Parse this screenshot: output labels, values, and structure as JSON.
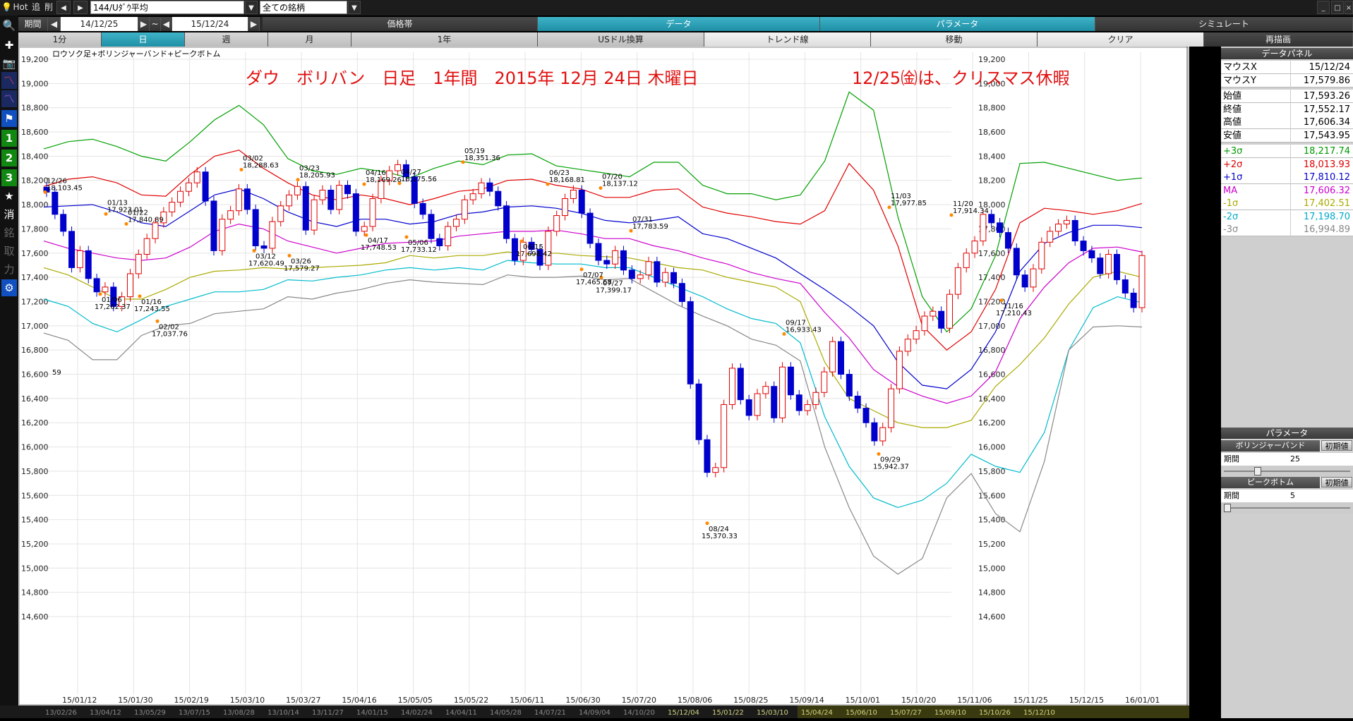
{
  "toolbar": {
    "hot": "Hot",
    "btn_add": "追",
    "btn_del": "削",
    "symbol": "144/Uﾀﾞｳ平均",
    "universe": "全ての銘柄",
    "period_label": "期間",
    "date_from": "14/12/25",
    "date_sep": "~",
    "date_to": "15/12/24"
  },
  "tabs_row1": [
    "価格帯",
    "データ",
    "パラメータ",
    "シミュレート"
  ],
  "tabs_row2": [
    "1分",
    "日",
    "週",
    "月",
    "1年",
    "USドル換算",
    "トレンド線",
    "移動",
    "クリア",
    "再描画"
  ],
  "left_tools": [
    "search-icon",
    "crosshair-icon",
    "camera-icon",
    "chart-red-icon",
    "chart-purple-icon",
    "flag-icon",
    "1",
    "2",
    "3",
    "★",
    "消",
    "銘",
    "取",
    "力"
  ],
  "chart_data": {
    "type": "candlestick",
    "subtitle": "ロウソク足+ボリンジャーバンド+ピークボトム",
    "title": "ダウ　ボリバン　日足　1年間　2015年 12月 24日 木曜日",
    "note": "12/25㈮は、クリスマス休暇",
    "ylim": [
      14600,
      19400
    ],
    "yticks": [
      "19,200",
      "19,000",
      "18,800",
      "18,600",
      "18,400",
      "18,200",
      "18,000",
      "17,800",
      "17,600",
      "17,400",
      "17,200",
      "17,000",
      "16,800",
      "16,600",
      "16,400",
      "16,200",
      "16,000",
      "15,800",
      "15,600",
      "15,400",
      "15,200",
      "15,000",
      "14,800",
      "14,600"
    ],
    "xticks": [
      "15/01/12",
      "15/01/30",
      "15/02/19",
      "15/03/10",
      "15/03/27",
      "15/04/16",
      "15/05/05",
      "15/05/22",
      "15/06/11",
      "15/06/30",
      "15/07/20",
      "15/08/06",
      "15/08/25",
      "15/09/14",
      "15/10/01",
      "15/10/20",
      "15/11/06",
      "15/11/25",
      "15/12/15",
      "16/01/01"
    ],
    "series": [
      {
        "name": "+3σ",
        "color": "#00a000",
        "values": [
          18460,
          18520,
          18540,
          18480,
          18400,
          18360,
          18520,
          18700,
          18820,
          18660,
          18380,
          18280,
          18250,
          18300,
          18270,
          18220,
          18300,
          18360,
          18330,
          18410,
          18420,
          18320,
          18290,
          18260,
          18230,
          18350,
          18350,
          18160,
          18090,
          18090,
          18040,
          18080,
          18360,
          18930,
          18780,
          17900,
          17240,
          16950,
          17140,
          17580,
          18340,
          18350,
          18300,
          18250,
          18200,
          18220
        ]
      },
      {
        "name": "+2σ",
        "color": "#e00000",
        "values": [
          18150,
          18210,
          18230,
          18180,
          18080,
          18070,
          18250,
          18400,
          18450,
          18300,
          18180,
          18080,
          18040,
          18080,
          18050,
          18000,
          18050,
          18110,
          18130,
          18200,
          18210,
          18160,
          18130,
          18060,
          18060,
          18120,
          18130,
          17980,
          17930,
          17900,
          17860,
          17840,
          17950,
          18340,
          18120,
          17660,
          17000,
          16800,
          16950,
          17300,
          17850,
          17970,
          17950,
          17920,
          17950,
          18010
        ]
      },
      {
        "name": "+1σ",
        "color": "#0000cc",
        "values": [
          17980,
          17990,
          18000,
          17940,
          17850,
          17820,
          17950,
          18080,
          18130,
          18050,
          17940,
          17860,
          17820,
          17880,
          17880,
          17840,
          17860,
          17920,
          17940,
          17980,
          17990,
          17970,
          17930,
          17870,
          17850,
          17870,
          17900,
          17760,
          17720,
          17640,
          17560,
          17430,
          17300,
          17160,
          17000,
          16700,
          16510,
          16480,
          16640,
          16950,
          17450,
          17680,
          17770,
          17830,
          17830,
          17810
        ]
      },
      {
        "name": "MA",
        "color": "#cc00cc",
        "values": [
          17700,
          17640,
          17600,
          17560,
          17540,
          17560,
          17650,
          17780,
          17840,
          17800,
          17700,
          17650,
          17600,
          17640,
          17680,
          17690,
          17700,
          17740,
          17760,
          17780,
          17780,
          17790,
          17760,
          17720,
          17720,
          17660,
          17620,
          17560,
          17510,
          17440,
          17390,
          17350,
          17110,
          16900,
          16640,
          16500,
          16420,
          16360,
          16420,
          16620,
          17060,
          17320,
          17520,
          17640,
          17650,
          17610
        ]
      },
      {
        "name": "-1σ",
        "color": "#aaaa00",
        "values": [
          17480,
          17420,
          17320,
          17220,
          17220,
          17300,
          17400,
          17450,
          17460,
          17480,
          17470,
          17480,
          17490,
          17500,
          17520,
          17580,
          17560,
          17580,
          17580,
          17610,
          17590,
          17600,
          17580,
          17570,
          17560,
          17520,
          17480,
          17460,
          17400,
          17360,
          17320,
          17200,
          16700,
          16400,
          16300,
          16200,
          16160,
          16160,
          16220,
          16500,
          16680,
          16900,
          17180,
          17400,
          17450,
          17400
        ]
      },
      {
        "name": "-2σ",
        "color": "#00bbcc",
        "values": [
          17220,
          17160,
          17020,
          16950,
          17050,
          17160,
          17220,
          17280,
          17280,
          17300,
          17380,
          17370,
          17400,
          17420,
          17460,
          17480,
          17460,
          17480,
          17460,
          17540,
          17520,
          17510,
          17510,
          17480,
          17480,
          17400,
          17320,
          17240,
          17140,
          17060,
          17020,
          16860,
          16250,
          15840,
          15580,
          15500,
          15560,
          15700,
          15940,
          15840,
          15790,
          16120,
          16800,
          17150,
          17240,
          17190
        ]
      },
      {
        "name": "-3σ",
        "color": "#888888",
        "values": [
          16940,
          16880,
          16720,
          16720,
          16920,
          17000,
          17020,
          17100,
          17120,
          17140,
          17240,
          17220,
          17270,
          17300,
          17350,
          17380,
          17360,
          17350,
          17340,
          17420,
          17400,
          17400,
          17410,
          17380,
          17390,
          17280,
          17170,
          17080,
          17000,
          16890,
          16840,
          16710,
          16000,
          15500,
          15100,
          14950,
          15080,
          15580,
          15780,
          15450,
          15300,
          15880,
          16800,
          16990,
          17000,
          16990
        ]
      }
    ],
    "candles": [
      18103,
      17920,
      17780,
      17480,
      17620,
      17390,
      17280,
      17320,
      17160,
      17240,
      17430,
      17590,
      17720,
      17850,
      17940,
      18020,
      18110,
      18180,
      18270,
      18030,
      17620,
      17880,
      17950,
      18130,
      17960,
      17660,
      17640,
      17860,
      17990,
      18080,
      18150,
      17790,
      18040,
      18120,
      17960,
      18160,
      18090,
      17780,
      17820,
      18050,
      18200,
      18280,
      18330,
      18230,
      18010,
      17920,
      17720,
      17660,
      17820,
      17880,
      18040,
      18090,
      18180,
      18110,
      17990,
      17720,
      17540,
      17690,
      17630,
      17500,
      17780,
      17910,
      18050,
      18120,
      17930,
      17680,
      17540,
      17510,
      17620,
      17460,
      17390,
      17420,
      17530,
      17360,
      17440,
      17350,
      17200,
      16520,
      16060,
      15790,
      15830,
      16350,
      16650,
      16390,
      16260,
      16440,
      16500,
      16240,
      16660,
      16430,
      16300,
      16350,
      16450,
      16620,
      16870,
      16600,
      16420,
      16320,
      16200,
      16050,
      16160,
      16480,
      16790,
      16890,
      16960,
      17080,
      17120,
      16980,
      17260,
      17480,
      17600,
      17700,
      17920,
      17850,
      17770,
      17640,
      17420,
      17320,
      17470,
      17690,
      17780,
      17840,
      17870,
      17700,
      17620,
      17560,
      17430,
      17590,
      17380,
      17270,
      17150,
      17580
    ],
    "peaks": [
      {
        "date": "12/26",
        "value": "18,103.45"
      },
      {
        "date": "01/13",
        "value": "17,923.01"
      },
      {
        "date": "01/22",
        "value": "17,840.89"
      },
      {
        "date": "03/02",
        "value": "18,288.63"
      },
      {
        "date": "03/23",
        "value": "18,205.93"
      },
      {
        "date": "04/16",
        "value": "18,169.26"
      },
      {
        "date": "04/27",
        "value": "18,175.56"
      },
      {
        "date": "05/19",
        "value": "18,351.36"
      },
      {
        "date": "06/23",
        "value": "18,168.81"
      },
      {
        "date": "07/20",
        "value": "18,137.12"
      },
      {
        "date": "07/31",
        "value": "17,783.59"
      },
      {
        "date": "09/17",
        "value": "16,933.43"
      },
      {
        "date": "11/03",
        "value": "17,977.85"
      },
      {
        "date": "11/20",
        "value": "17,914.34"
      }
    ],
    "bottoms": [
      {
        "date": "01/06",
        "value": "17,262.37"
      },
      {
        "date": "01/16",
        "value": "17,243.55"
      },
      {
        "date": "02/02",
        "value": "17,037.76"
      },
      {
        "date": "03/12",
        "value": "17,620.49"
      },
      {
        "date": "03/26",
        "value": "17,579.27"
      },
      {
        "date": "04/17",
        "value": "17,748.53"
      },
      {
        "date": "05/06",
        "value": "17,733.12"
      },
      {
        "date": "06/15",
        "value": "17,698.42"
      },
      {
        "date": "07/07",
        "value": "17,465.68"
      },
      {
        "date": "07/27",
        "value": "17,399.17"
      },
      {
        "date": "08/24",
        "value": "15,370.33"
      },
      {
        "date": "09/29",
        "value": "15,942.37"
      },
      {
        "date": "11/16",
        "value": "17,210.43"
      }
    ],
    "left_cut_label": "59"
  },
  "data_panel": {
    "title": "データパネル",
    "rows": [
      {
        "label": "マウスX",
        "value": "15/12/24",
        "color": "#000000"
      },
      {
        "label": "マウスY",
        "value": "17,579.86",
        "color": "#000000"
      },
      {
        "label": "始値",
        "value": "17,593.26",
        "color": "#000000"
      },
      {
        "label": "終値",
        "value": "17,552.17",
        "color": "#000000"
      },
      {
        "label": "高値",
        "value": "17,606.34",
        "color": "#000000"
      },
      {
        "label": "安値",
        "value": "17,543.95",
        "color": "#000000"
      },
      {
        "label": "+3σ",
        "value": "18,217.74",
        "color": "#009900"
      },
      {
        "label": "+2σ",
        "value": "18,013.93",
        "color": "#dd0000"
      },
      {
        "label": "+1σ",
        "value": "17,810.12",
        "color": "#0000cc"
      },
      {
        "label": "MA",
        "value": "17,606.32",
        "color": "#cc00cc"
      },
      {
        "label": "-1σ",
        "value": "17,402.51",
        "color": "#aaaa00"
      },
      {
        "label": "-2σ",
        "value": "17,198.70",
        "color": "#00aacc"
      },
      {
        "label": "-3σ",
        "value": "16,994.89",
        "color": "#888888"
      }
    ]
  },
  "param_panel": {
    "title": "パラメータ",
    "bb_label": "ボリンジャーバンド",
    "bb_reset": "初期値",
    "bb_period_label": "期間",
    "bb_period_value": "25",
    "pb_label": "ピークボトム",
    "pb_reset": "初期値",
    "pb_period_label": "期間",
    "pb_period_value": "5"
  },
  "timeline": [
    "13/02/26",
    "13/04/12",
    "13/05/29",
    "13/07/15",
    "13/08/28",
    "13/10/14",
    "13/11/27",
    "14/01/15",
    "14/02/24",
    "14/04/11",
    "14/05/28",
    "14/07/21",
    "14/09/04",
    "14/10/20",
    "15/12/04",
    "15/01/22",
    "15/03/10",
    "15/04/24",
    "15/06/10",
    "15/07/27",
    "15/09/10",
    "15/10/26",
    "15/12/10"
  ]
}
